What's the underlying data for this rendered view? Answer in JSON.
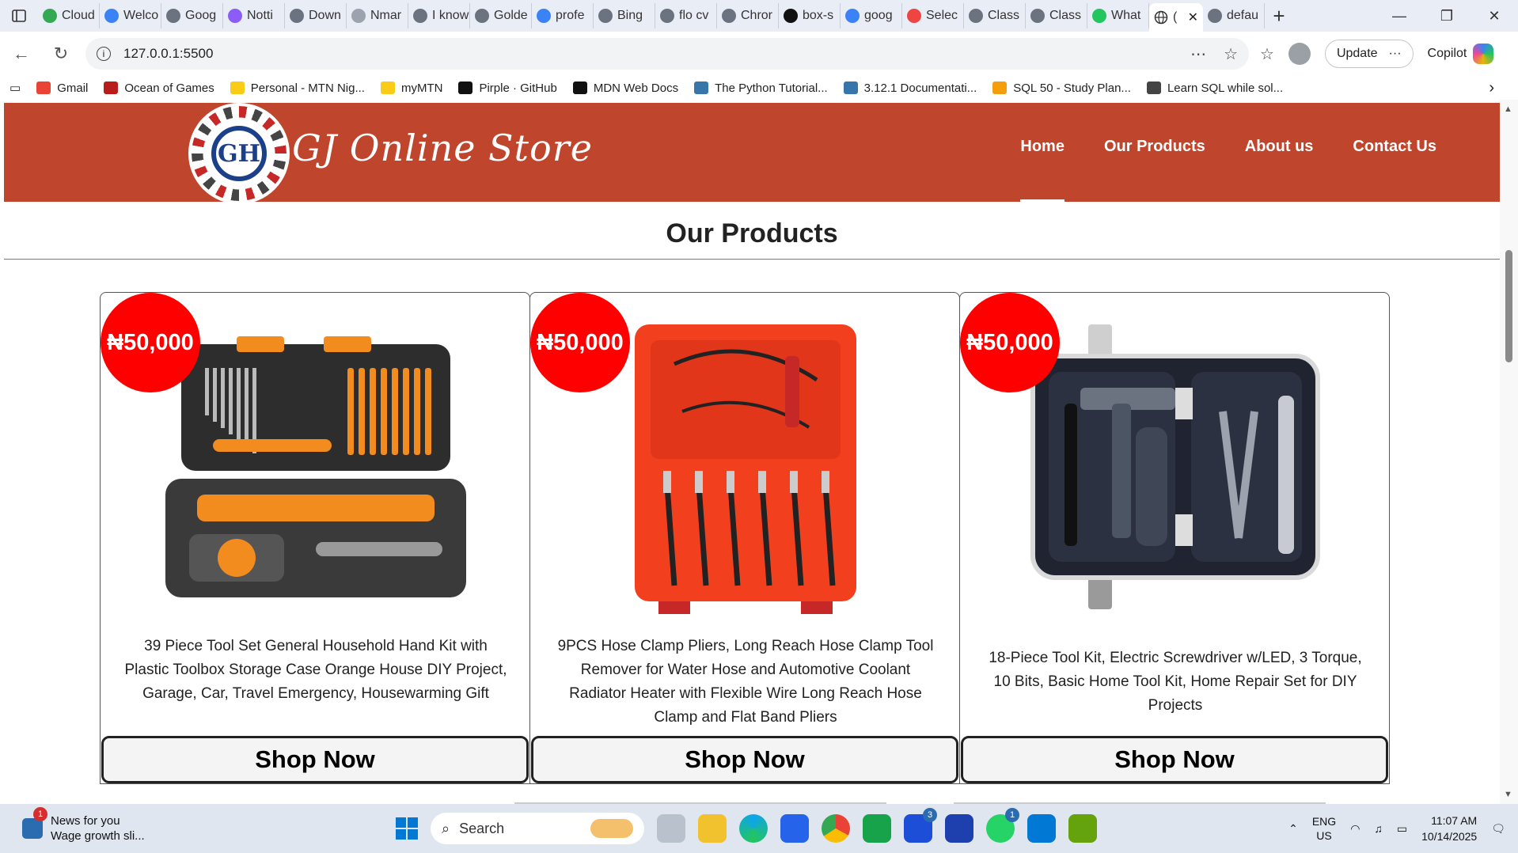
{
  "browser": {
    "tabs": [
      {
        "label": "Cloud",
        "color": "#34a853"
      },
      {
        "label": "Welco",
        "color": "#3b82f6"
      },
      {
        "label": "Goog",
        "color": "#6b7280"
      },
      {
        "label": "Notti",
        "color": "#8b5cf6"
      },
      {
        "label": "Down",
        "color": "#6b7280"
      },
      {
        "label": "Nmar",
        "color": "#9ca3af"
      },
      {
        "label": "I know",
        "color": "#6b7280"
      },
      {
        "label": "Golde",
        "color": "#6b7280"
      },
      {
        "label": "profe",
        "color": "#3b82f6"
      },
      {
        "label": "Bing",
        "color": "#6b7280"
      },
      {
        "label": "flo cv",
        "color": "#6b7280"
      },
      {
        "label": "Chror",
        "color": "#6b7280"
      },
      {
        "label": "box-s",
        "color": "#111111"
      },
      {
        "label": "goog",
        "color": "#3b82f6"
      },
      {
        "label": "Selec",
        "color": "#ef4444"
      },
      {
        "label": "Class",
        "color": "#6b7280"
      },
      {
        "label": "Class",
        "color": "#6b7280"
      },
      {
        "label": "What",
        "color": "#22c55e"
      }
    ],
    "active_tab_label": "(",
    "trailing_tab_label": "defau",
    "url": "127.0.0.1:5500",
    "update_label": "Update",
    "copilot_label": "Copilot"
  },
  "bookmarks": [
    {
      "label": "Gmail",
      "color": "#ea4335"
    },
    {
      "label": "Ocean of Games",
      "color": "#b91c1c"
    },
    {
      "label": "Personal - MTN Nig...",
      "color": "#facc15"
    },
    {
      "label": "myMTN",
      "color": "#facc15"
    },
    {
      "label": "Pirple · GitHub",
      "color": "#111111"
    },
    {
      "label": "MDN Web Docs",
      "color": "#111111"
    },
    {
      "label": "The Python Tutorial...",
      "color": "#3776ab"
    },
    {
      "label": "3.12.1 Documentati...",
      "color": "#3776ab"
    },
    {
      "label": "SQL 50 - Study Plan...",
      "color": "#f59e0b"
    },
    {
      "label": "Learn SQL while sol...",
      "color": "#444444"
    }
  ],
  "site": {
    "store_name": "GJ Online Store",
    "logo_letters": "GH",
    "nav": [
      "Home",
      "Our Products",
      "About us",
      "Contact Us"
    ],
    "active_nav": "Home",
    "section_title": "Our Products"
  },
  "products": [
    {
      "price": "₦50,000",
      "description": "39 Piece Tool Set General Household Hand Kit with Plastic Toolbox Storage Case Orange House DIY Project, Garage, Car, Travel Emergency, Housewarming Gift",
      "button": "Shop Now",
      "image": "orange-toolbox"
    },
    {
      "price": "₦50,000",
      "description": "9PCS Hose Clamp Pliers, Long Reach Hose Clamp Tool Remover for Water Hose and Automotive Coolant Radiator Heater with Flexible Wire Long Reach Hose Clamp and Flat Band Pliers",
      "button": "Shop Now",
      "image": "red-plier-case"
    },
    {
      "price": "₦50,000",
      "description": "18-Piece Tool Kit, Electric Screwdriver w/LED, 3 Torque, 10 Bits, Basic Home Tool Kit, Home Repair Set for DIY Projects",
      "button": "Shop Now",
      "image": "dark-tool-case"
    }
  ],
  "taskbar": {
    "news_title": "News for you",
    "news_subtitle": "Wage growth sli...",
    "news_badge": "1",
    "search_placeholder": "Search",
    "store_badge": "3",
    "whatsapp_badge": "1",
    "lang_top": "ENG",
    "lang_bottom": "US",
    "time": "11:07 AM",
    "date": "10/14/2025"
  }
}
